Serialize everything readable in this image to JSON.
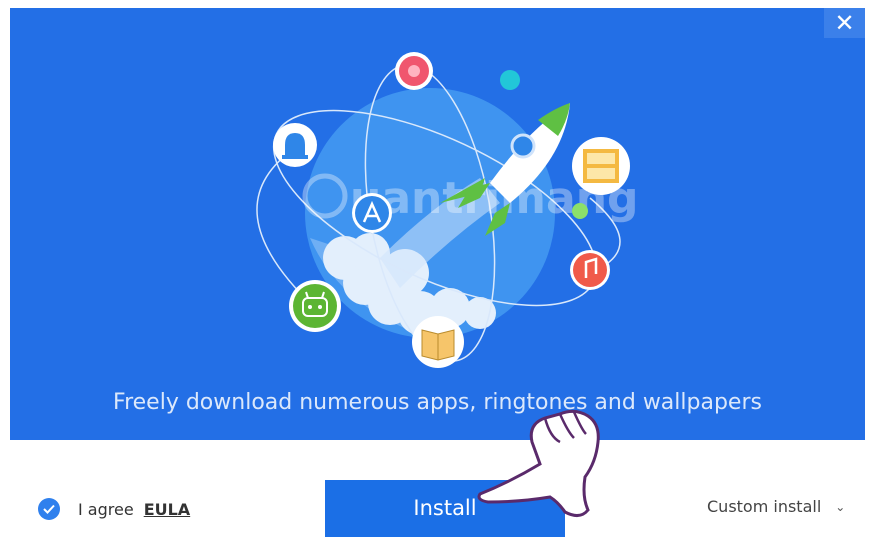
{
  "window": {
    "close_glyph": "✕"
  },
  "hero": {
    "tagline": "Freely download numerous apps, ringtones and wallpapers",
    "watermark": "uantrimang",
    "icons": [
      "bell-icon",
      "flower-icon",
      "film-wallpaper-icon",
      "music-icon",
      "book-icon",
      "robot-icon",
      "app-store-icon",
      "rocket-icon"
    ]
  },
  "footer": {
    "agree_label": "I agree",
    "eula_label": "EULA",
    "install_label": "Install",
    "custom_label": "Custom install",
    "custom_chevron": "⌄"
  },
  "colors": {
    "hero_bg": "#236fe6",
    "install_bg": "#1b6fe6",
    "check_bg": "#2f80ed"
  }
}
